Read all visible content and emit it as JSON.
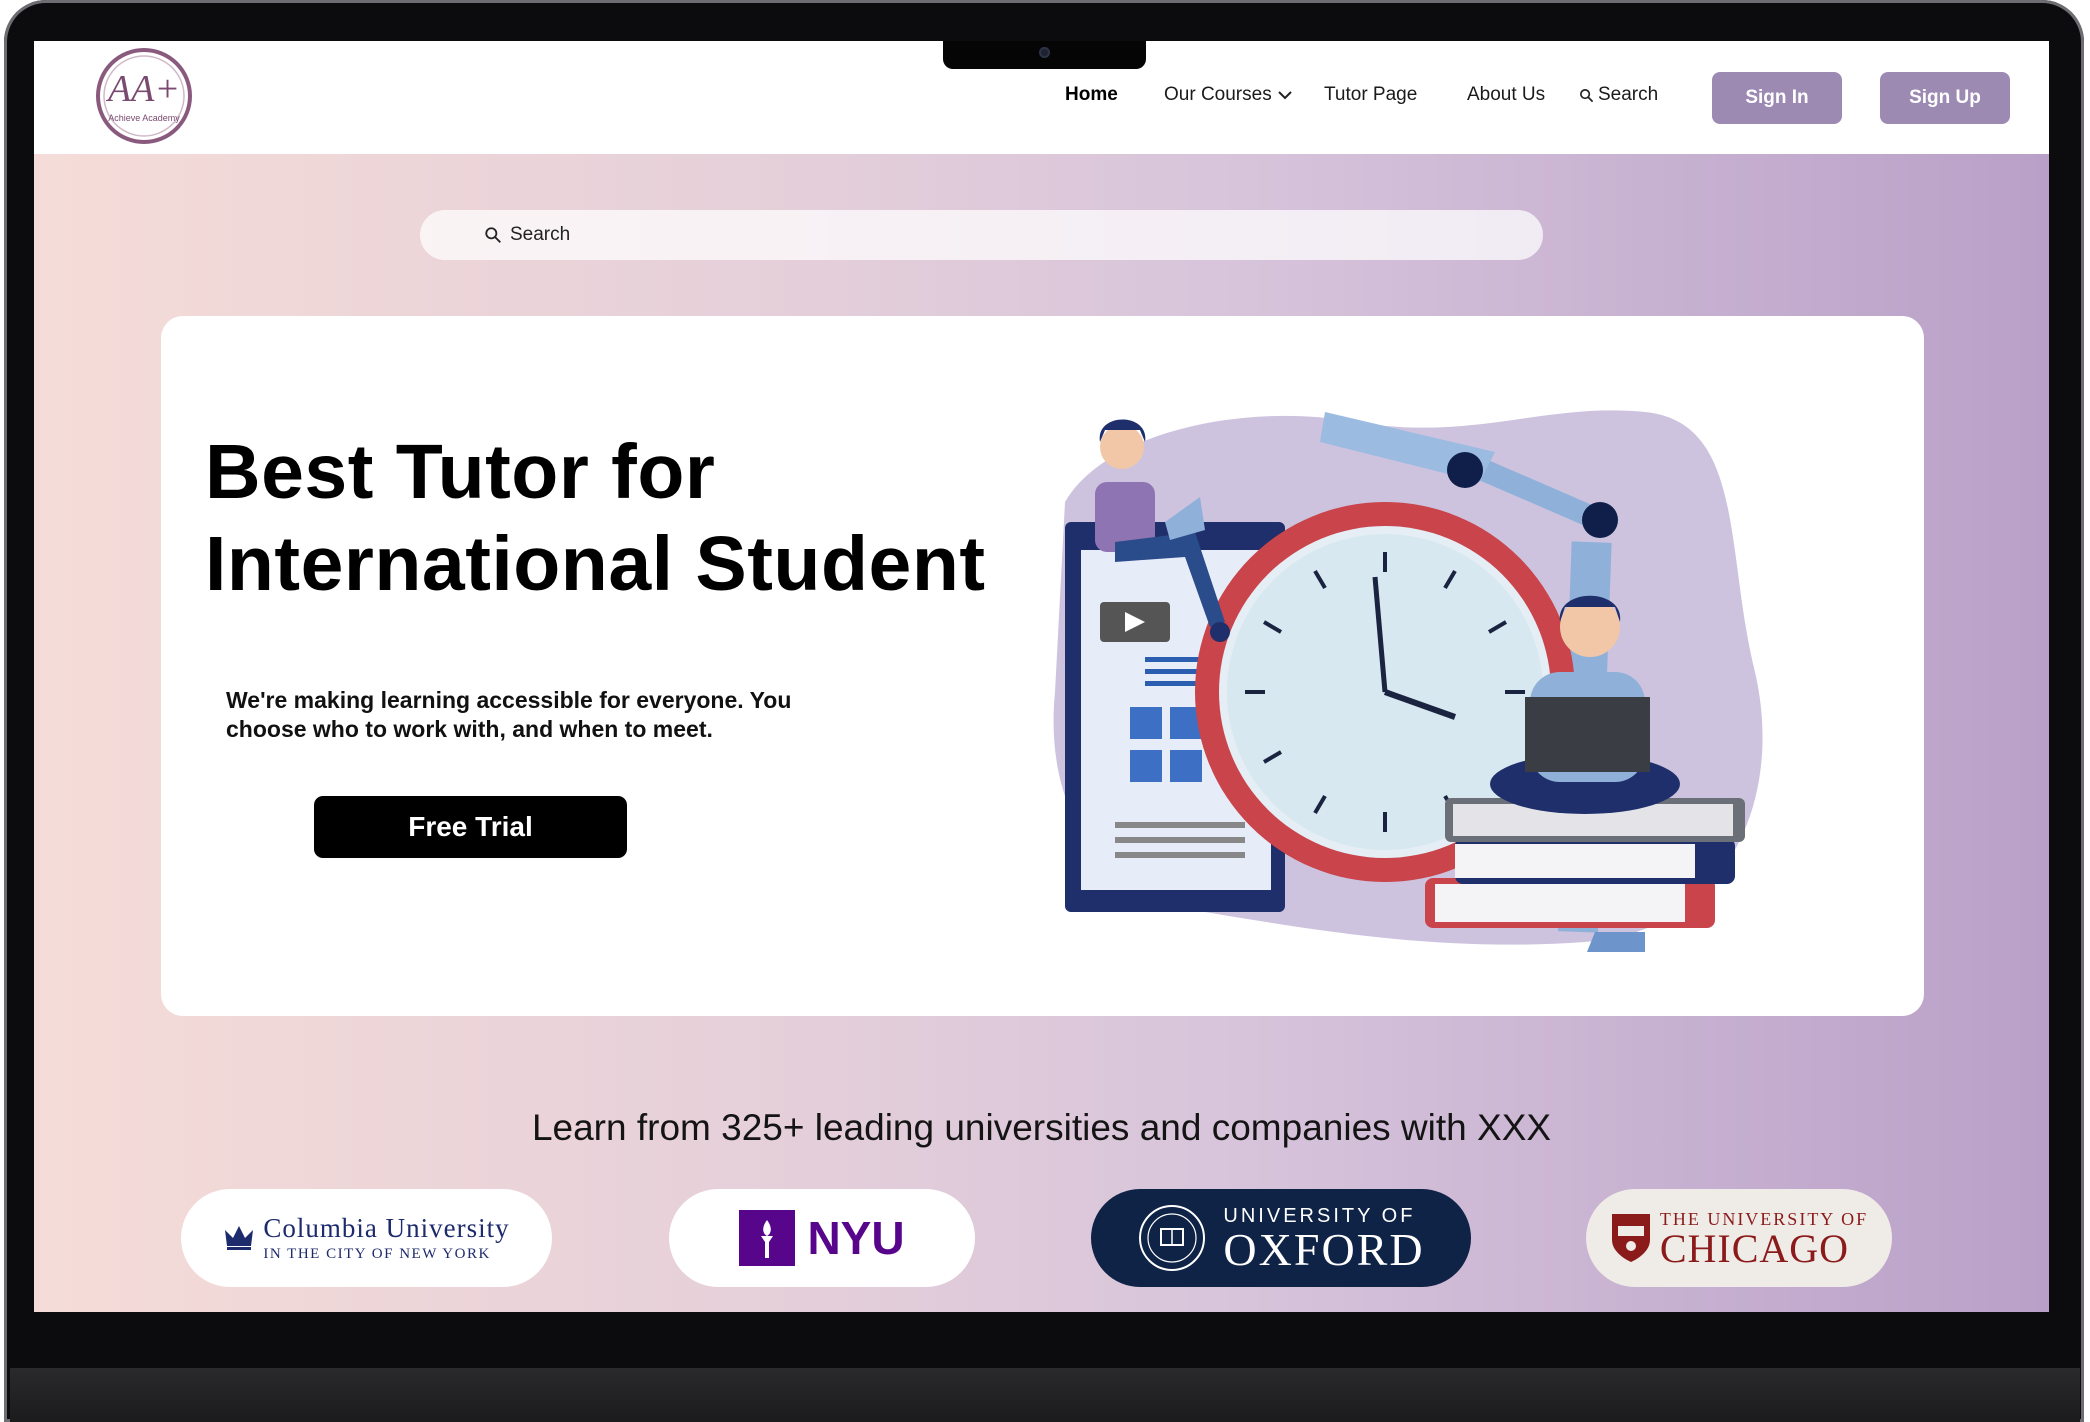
{
  "nav": {
    "logo_text": "AA+",
    "logo_subtext": "Achieve Academy",
    "links": {
      "home": "Home",
      "courses": "Our Courses",
      "tutor": "Tutor Page",
      "about": "About Us",
      "search": "Search"
    },
    "sign_in": "Sign In",
    "sign_up": "Sign Up"
  },
  "search": {
    "placeholder": "Search"
  },
  "hero": {
    "title_line1": "Best Tutor for",
    "title_line2": "International Student",
    "subtitle": "We're making learning accessible for everyone. You choose who to work with, and when to meet.",
    "cta": "Free Trial"
  },
  "partners": {
    "tagline": "Learn from 325+ leading universities and companies with XXX",
    "columbia": {
      "line1": "Columbia University",
      "line2": "IN THE CITY OF NEW YORK"
    },
    "nyu": {
      "name": "NYU"
    },
    "oxford": {
      "line1": "UNIVERSITY OF",
      "line2": "OXFORD"
    },
    "chicago": {
      "line1": "THE UNIVERSITY OF",
      "line2": "CHICAGO"
    }
  },
  "colors": {
    "accent_button": "#9d8ab3",
    "hero_gradient_start": "#f5dcd8",
    "hero_gradient_end": "#b9a0c8",
    "cta_background": "#000000"
  }
}
